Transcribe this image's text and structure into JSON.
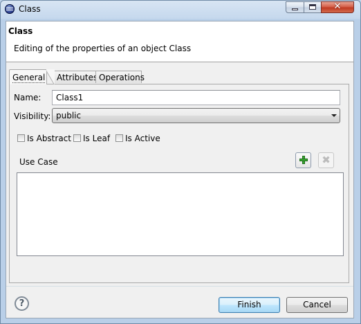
{
  "window": {
    "title": "Class",
    "minimize_icon": "minimize-icon",
    "maximize_icon": "maximize-icon",
    "close_icon": "close-icon"
  },
  "header": {
    "title": "Class",
    "message": "Editing of the properties of an object Class"
  },
  "tabs": [
    {
      "label": "General",
      "active": true
    },
    {
      "label": "Attributes",
      "active": false
    },
    {
      "label": "Operations",
      "active": false
    }
  ],
  "form": {
    "name_label": "Name:",
    "name_value": "Class1",
    "visibility_label": "Visibility:",
    "visibility_value": "public",
    "checkboxes": [
      {
        "label": "Is Abstract",
        "checked": false
      },
      {
        "label": "Is Leaf",
        "checked": false
      },
      {
        "label": "Is Active",
        "checked": false
      }
    ],
    "use_case_label": "Use Case",
    "use_case_items": []
  },
  "footer": {
    "help_glyph": "?",
    "finish_label": "Finish",
    "cancel_label": "Cancel"
  },
  "colors": {
    "title_bar": "#c5d8ed",
    "close_button": "#c03a22",
    "add_icon": "#39a832",
    "default_button_border": "#3c7fb1"
  }
}
